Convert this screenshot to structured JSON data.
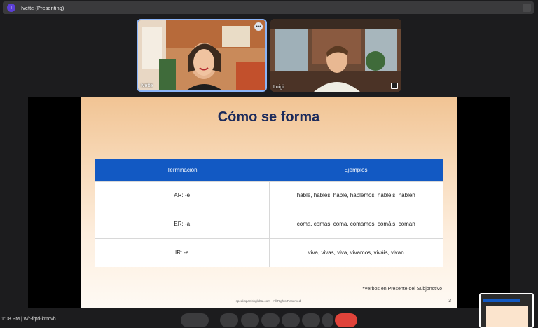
{
  "topbar": {
    "avatar_initial": "I",
    "title": "Ivette (Presenting)"
  },
  "participants": [
    {
      "name": "Ivette"
    },
    {
      "name": "Luigi"
    }
  ],
  "tile_more_label": "•••",
  "slide": {
    "title": "Cómo se forma",
    "table": {
      "headers": [
        "Terminación",
        "Ejemplos"
      ],
      "rows": [
        [
          "AR: -e",
          "hable, hables, hable, hablemos, habléis, hablen"
        ],
        [
          "ER: -a",
          "coma, comas, coma, comamos, comáis, coman"
        ],
        [
          "IR: -a",
          "viva, vivas, viva, vivamos, viváis, vivan"
        ]
      ]
    },
    "note": "*Verbos en Presente del Subjonctivo",
    "footer": "speakspanishglobal.com - All Rights Reserved.",
    "page_number": "3"
  },
  "bottom_left_text": "1:08 PM | w/r-fqtd-kmcvh",
  "colors": {
    "header_blue": "#1259c3",
    "title_navy": "#1b2a5b",
    "end_call_red": "#e0433a",
    "active_border": "#8ab4f8"
  }
}
